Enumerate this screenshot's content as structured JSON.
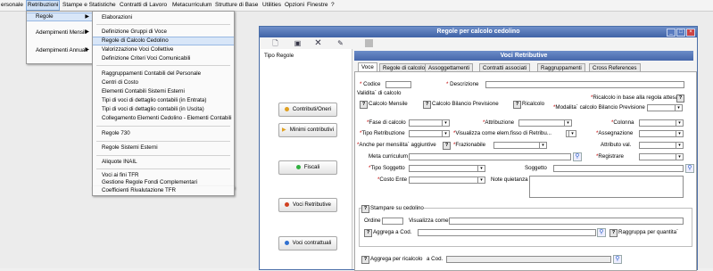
{
  "menubar": {
    "items": [
      "ersonale",
      "Retribuzioni",
      "Stampe e Statistiche",
      "Contratti di Lavoro",
      "Metacurriculum",
      "Strutture di Base",
      "Utilities",
      "Opzioni",
      "Finestre",
      "?"
    ]
  },
  "menu1": {
    "items": [
      "Regole",
      "Adempimenti Mensili",
      "Adempimenti Annuali"
    ]
  },
  "menu2": {
    "items": [
      "Elaborazioni",
      "Definizione Gruppi di Voce",
      "Regole di Calcolo Cedolino",
      "Valorizzazione Voci Collettive",
      "Definizione Criteri Voci Comunicabili",
      "Raggruppamenti Contabili del Personale",
      "Centri di Costo",
      "Elementi Contabili Sistemi Esterni",
      "Tipi di voci di dettaglio contabili (in Entrata)",
      "Tipi di voci di dettaglio contabili (in Uscita)",
      "Collegamento Elementi Cedolino - Elementi Contabili",
      "Regole 730",
      "Regole Sistemi Esterni",
      "Aliquote INAIL",
      "Voci ai fini TFR",
      "Gestione Regole Fondi Complementari",
      "Coefficienti Rivalutazione TFR"
    ]
  },
  "window": {
    "title": "Regole per calcolo cedolino",
    "left_title": "Tipo Regole",
    "left_buttons": [
      "Contributi/Oneri",
      "Minimi contributivi",
      "Fiscali",
      "Voci Retributive",
      "Voci contrattuali"
    ],
    "section_title": "Voci Retributive",
    "tabs": [
      "Voce",
      "Regole di calcolo",
      "Assoggettamenti",
      "Contratti associati",
      "Raggruppamenti",
      "Cross References"
    ]
  },
  "form": {
    "codice": "Codice",
    "descrizione": "Descrizione",
    "validita": "Validita` di calcolo",
    "calc_mensile": "Calcolo Mensile",
    "calc_bilancio": "Calcolo Bilancio Previsione",
    "ricalcolo": "Ricalcolo",
    "ricalcolo_regola": "Ricalcolo in base alla regola attesa",
    "modalita": "Modalita` calcolo Bilancio Previsione",
    "fase": "Fase di calcolo",
    "attribuzione": "Attribuzione",
    "colonna": "Colonna",
    "tipo_retribuzione": "Tipo Retribuzione",
    "visualizza_elem": "Visualizza come elem.fisso di Retribu...",
    "assegnazione": "Assegnazione",
    "anche_mensilita": "Anche per mensilita` aggiuntive",
    "frazionabile": "Frazionabile",
    "attributo_val": "Attributo val.",
    "meta_curriculum": "Meta curriculum",
    "registrare": "Registrare",
    "tipo_soggetto": "Tipo Soggetto",
    "soggetto": "Soggetto",
    "costo_ente": "Costo Ente",
    "note_quietanza": "Note quietanza",
    "stampare": "Stampare su cedolino",
    "ordine": "Ordine",
    "visualizza_come": "Visualizza come",
    "aggrega_cod": "Aggrega",
    "a_cod": "a Cod.",
    "raggruppa": "Raggruppa per quantita`",
    "aggrega_ricalcolo": "Aggrega per ricalcolo",
    "a_cod2": "a Cod."
  },
  "colors": {
    "title_blue": "#3f62a6",
    "accent_select": "#d8e6f8",
    "required_red": "#c00000"
  }
}
